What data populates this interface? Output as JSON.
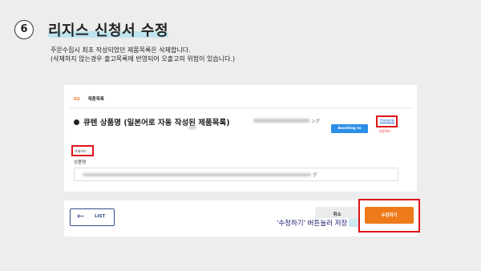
{
  "header": {
    "step_number": "6",
    "title": "리지스 신청서 수정"
  },
  "description": {
    "line1": "주문수집시 최초 작성되었던 제품목록은 삭제합니다.",
    "line2": "(삭제하지 않는경우 출고목록에 반영되어 오출고의 위험이 있습니다.)"
  },
  "section": {
    "number": "02",
    "label": "제품목록"
  },
  "product": {
    "title": "큐텐 상품명 (일본어로 자동 작성된 제품목록)",
    "suffix": "ング",
    "status_badge": "Awaiting to online",
    "delete_label": "Delete",
    "delete_sub": "다운로드"
  },
  "field": {
    "delete_button": "삭제하기",
    "label": "상품명",
    "input_suffix": "グ"
  },
  "footer": {
    "list_arrow": "←",
    "list_label": "LIST",
    "cancel_label": "취소",
    "save_label": "수정하기",
    "caption": "'수정하기' 버튼눌러 저장"
  }
}
